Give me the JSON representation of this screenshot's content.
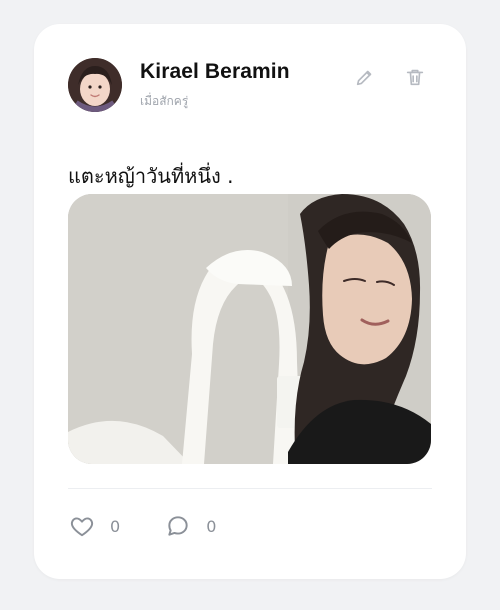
{
  "post": {
    "author": "Kirael Beramin",
    "timestamp": "เมื่อสักครู่",
    "text": "แตะหญ้าวันที่หนึ่ง .",
    "likes": "0",
    "comments": "0"
  },
  "icons": {
    "edit": "pencil-icon",
    "delete": "trash-icon",
    "like": "heart-icon",
    "comment": "comment-icon"
  },
  "colors": {
    "card": "#ffffff",
    "page": "#f1f2f4",
    "muted": "#a0a5ad",
    "icon": "#b6bac1"
  }
}
